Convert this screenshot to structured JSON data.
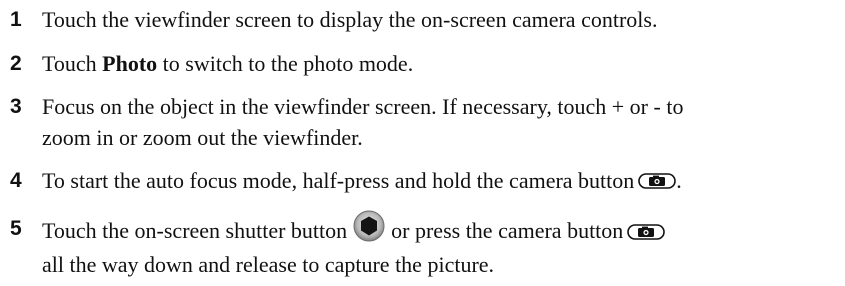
{
  "steps": [
    {
      "number": "1",
      "text": "Touch the viewfinder screen to display the on-screen camera controls."
    },
    {
      "number": "2",
      "pre": "Touch ",
      "bold": "Photo",
      "post": " to switch to the photo mode."
    },
    {
      "number": "3",
      "line1": "Focus on the object in the viewfinder screen. If necessary, touch + or - to",
      "line2": "zoom in or zoom out the viewfinder."
    },
    {
      "number": "4",
      "text": "To start the auto focus mode, half-press and hold the camera button",
      "icon": "camera-button-icon",
      "after": "."
    },
    {
      "number": "5",
      "pre": "Touch the on-screen shutter button",
      "icon1": "shutter-button-icon",
      "mid": "or press the camera button",
      "icon2": "camera-button-icon",
      "line2": "all the way down and release to capture the picture."
    }
  ]
}
